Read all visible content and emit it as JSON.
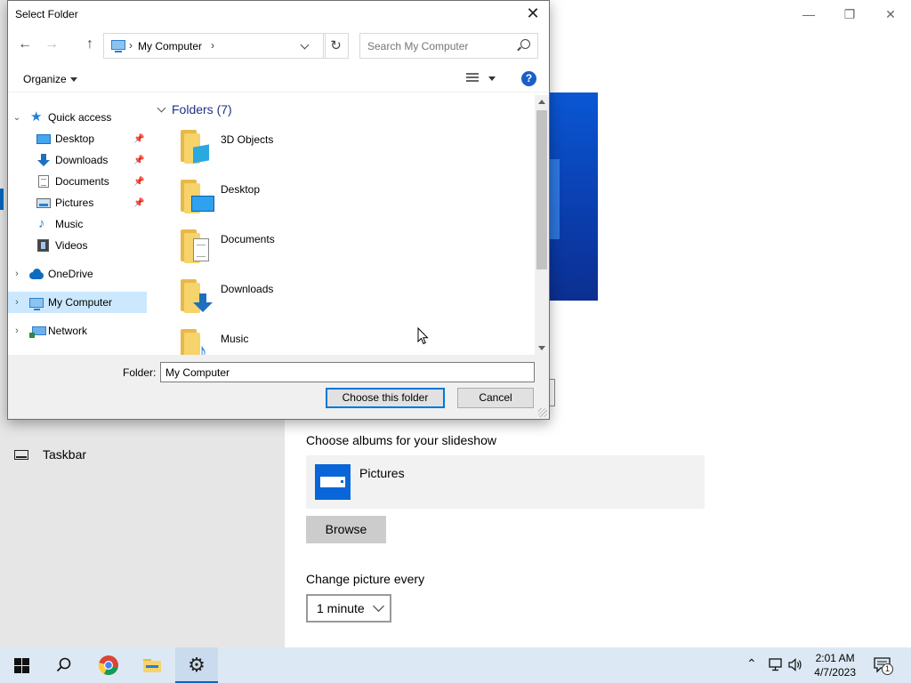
{
  "settings": {
    "taskbar_label": "Taskbar",
    "albums_label": "Choose albums for your slideshow",
    "album_name": "Pictures",
    "browse_label": "Browse",
    "change_label": "Change picture every",
    "interval_value": "1 minute"
  },
  "dialog": {
    "title": "Select Folder",
    "address_path": "My Computer",
    "search_placeholder": "Search My Computer",
    "organize_label": "Organize",
    "group_header": "Folders (7)",
    "nav": [
      {
        "label": "Quick access",
        "icon": "star-icon"
      },
      {
        "label": "Desktop",
        "icon": "desktop-icon"
      },
      {
        "label": "Downloads",
        "icon": "downloads-icon"
      },
      {
        "label": "Documents",
        "icon": "documents-icon"
      },
      {
        "label": "Pictures",
        "icon": "pictures-icon"
      },
      {
        "label": "Music",
        "icon": "music-icon"
      },
      {
        "label": "Videos",
        "icon": "videos-icon"
      },
      {
        "label": "OneDrive",
        "icon": "onedrive-icon"
      },
      {
        "label": "My Computer",
        "icon": "computer-icon"
      },
      {
        "label": "Network",
        "icon": "network-icon"
      }
    ],
    "folders": [
      {
        "name": "3D Objects"
      },
      {
        "name": "Desktop"
      },
      {
        "name": "Documents"
      },
      {
        "name": "Downloads"
      },
      {
        "name": "Music"
      }
    ],
    "folder_label": "Folder:",
    "folder_value": "My Computer",
    "choose_label": "Choose this folder",
    "cancel_label": "Cancel"
  },
  "taskbar": {
    "time": "2:01 AM",
    "date": "4/7/2023",
    "notification_count": "1"
  },
  "colors": {
    "accent": "#0067c0",
    "selected": "#cce8ff",
    "group_header": "#1e3287",
    "folder": "#f6d36b"
  }
}
